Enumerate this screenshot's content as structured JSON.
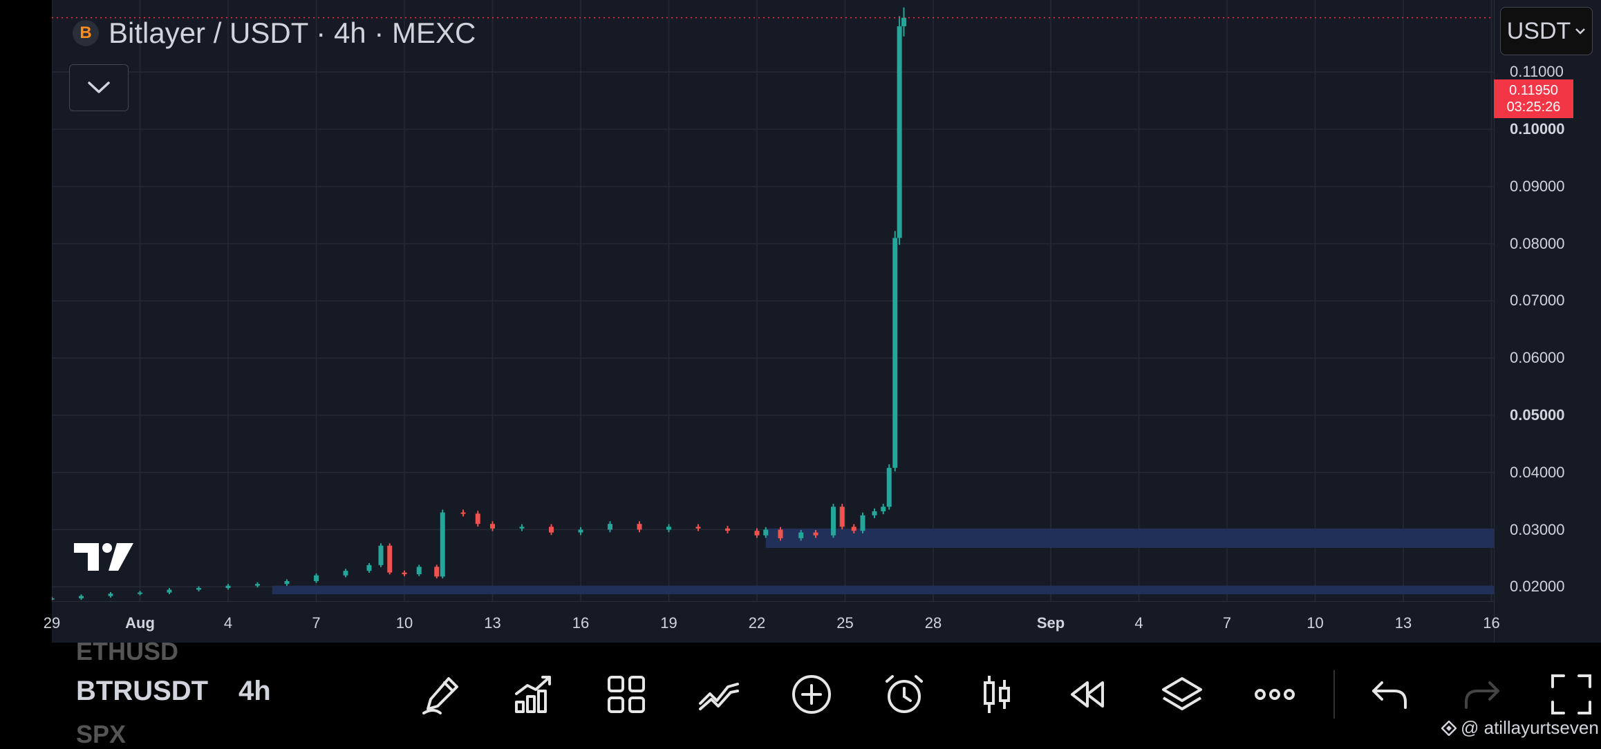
{
  "header": {
    "title": "Bitlayer / USDT · 4h · MEXC",
    "logo_glyph": "B",
    "currency": "USDT"
  },
  "price_axis": {
    "ticks": [
      {
        "label": "0.11000",
        "bold": false,
        "value": 0.11
      },
      {
        "label": "0.10000",
        "bold": true,
        "value": 0.1
      },
      {
        "label": "0.09000",
        "bold": false,
        "value": 0.09
      },
      {
        "label": "0.08000",
        "bold": false,
        "value": 0.08
      },
      {
        "label": "0.07000",
        "bold": false,
        "value": 0.07
      },
      {
        "label": "0.06000",
        "bold": false,
        "value": 0.06
      },
      {
        "label": "0.05000",
        "bold": true,
        "value": 0.05
      },
      {
        "label": "0.04000",
        "bold": false,
        "value": 0.04
      },
      {
        "label": "0.03000",
        "bold": false,
        "value": 0.03
      },
      {
        "label": "0.02000",
        "bold": false,
        "value": 0.02
      }
    ],
    "current_price": "0.11950",
    "countdown": "03:25:26"
  },
  "time_axis": {
    "ticks": [
      {
        "label": "29",
        "bold": false,
        "day": 0
      },
      {
        "label": "Aug",
        "bold": true,
        "day": 3
      },
      {
        "label": "4",
        "bold": false,
        "day": 6
      },
      {
        "label": "7",
        "bold": false,
        "day": 9
      },
      {
        "label": "10",
        "bold": false,
        "day": 12
      },
      {
        "label": "13",
        "bold": false,
        "day": 15
      },
      {
        "label": "16",
        "bold": false,
        "day": 18
      },
      {
        "label": "19",
        "bold": false,
        "day": 21
      },
      {
        "label": "22",
        "bold": false,
        "day": 24
      },
      {
        "label": "25",
        "bold": false,
        "day": 27
      },
      {
        "label": "28",
        "bold": false,
        "day": 30
      },
      {
        "label": "Sep",
        "bold": true,
        "day": 34
      },
      {
        "label": "4",
        "bold": false,
        "day": 37
      },
      {
        "label": "7",
        "bold": false,
        "day": 40
      },
      {
        "label": "10",
        "bold": false,
        "day": 43
      },
      {
        "label": "13",
        "bold": false,
        "day": 46
      },
      {
        "label": "16",
        "bold": false,
        "day": 49
      }
    ]
  },
  "chart_data": {
    "type": "candlestick",
    "x_unit": "day",
    "ylim": [
      0.0175,
      0.1226
    ],
    "up_color": "#26a69a",
    "down_color": "#ef5350",
    "zones": [
      {
        "low": 0.0268,
        "high": 0.0302,
        "from_day": 24.3
      },
      {
        "low": 0.0187,
        "high": 0.0202,
        "from_day": 7.5
      }
    ],
    "closes": [
      [
        0.0,
        0.018
      ],
      [
        1.0,
        0.0184
      ],
      [
        2.0,
        0.0188
      ],
      [
        3.0,
        0.019
      ],
      [
        4.0,
        0.0195
      ],
      [
        5.0,
        0.0198
      ],
      [
        6.0,
        0.0202
      ],
      [
        7.0,
        0.0205
      ],
      [
        8.0,
        0.021
      ],
      [
        9.0,
        0.022
      ],
      [
        10.0,
        0.0228
      ],
      [
        10.8,
        0.0238
      ],
      [
        11.2,
        0.0272
      ],
      [
        11.5,
        0.0225
      ],
      [
        12.0,
        0.0222
      ],
      [
        12.5,
        0.0235
      ],
      [
        13.1,
        0.0218
      ],
      [
        13.3,
        0.033
      ],
      [
        14.0,
        0.0328
      ],
      [
        14.5,
        0.031
      ],
      [
        15.0,
        0.0302
      ],
      [
        16.0,
        0.0305
      ],
      [
        17.0,
        0.0295
      ],
      [
        18.0,
        0.03
      ],
      [
        19.0,
        0.031
      ],
      [
        20.0,
        0.03
      ],
      [
        21.0,
        0.0305
      ],
      [
        22.0,
        0.0302
      ],
      [
        23.0,
        0.0298
      ],
      [
        24.0,
        0.029
      ],
      [
        24.3,
        0.03
      ],
      [
        24.8,
        0.0285
      ],
      [
        25.5,
        0.0295
      ],
      [
        26.0,
        0.029
      ],
      [
        26.6,
        0.034
      ],
      [
        26.9,
        0.0305
      ],
      [
        27.3,
        0.0298
      ],
      [
        27.6,
        0.0325
      ],
      [
        28.0,
        0.0332
      ],
      [
        28.3,
        0.034
      ],
      [
        28.5,
        0.0408
      ],
      [
        28.7,
        0.081
      ],
      [
        28.85,
        0.118
      ],
      [
        29.0,
        0.1195
      ]
    ]
  },
  "toolbar": {
    "symbol_prev": "ETHUSD",
    "symbol_current": "BTRUSDT",
    "symbol_next": "SPX",
    "interval": "4h",
    "watermark": "@ atillayurtseven"
  }
}
